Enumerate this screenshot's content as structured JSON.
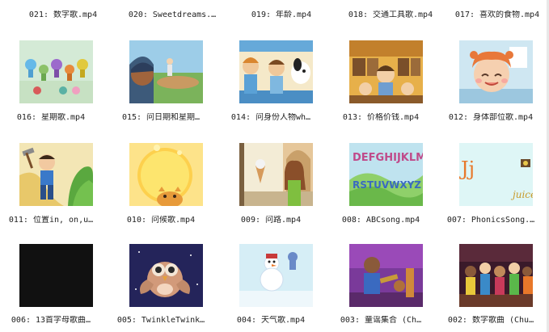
{
  "files": [
    {
      "label": "021: 数字歌.mp4",
      "icon": "video-file-icon"
    },
    {
      "label": "020: Sweetdreams.…",
      "icon": "video-file-icon"
    },
    {
      "label": "019: 年龄.mp4",
      "icon": "video-file-icon"
    },
    {
      "label": "018: 交通工具歌.mp4",
      "icon": "video-file-icon"
    },
    {
      "label": "017: 喜欢的食物.mp4",
      "icon": "video-file-icon"
    },
    {
      "label": "016: 星期歌.mp4",
      "icon": "video-thumbnail"
    },
    {
      "label": "015: 问日期和星期…",
      "icon": "video-thumbnail"
    },
    {
      "label": "014: 问身份人物wh…",
      "icon": "video-thumbnail"
    },
    {
      "label": "013: 价格价钱.mp4",
      "icon": "video-thumbnail"
    },
    {
      "label": "012: 身体部位歌.mp4",
      "icon": "video-thumbnail"
    },
    {
      "label": "011: 位置in, on,u…",
      "icon": "video-thumbnail"
    },
    {
      "label": "010: 问候歌.mp4",
      "icon": "video-thumbnail"
    },
    {
      "label": "009: 问路.mp4",
      "icon": "video-thumbnail"
    },
    {
      "label": "008: ABCsong.mp4",
      "icon": "video-thumbnail"
    },
    {
      "label": "007: PhonicsSong.…",
      "icon": "video-thumbnail"
    },
    {
      "label": "006: 13首字母歌曲…",
      "icon": "video-thumbnail"
    },
    {
      "label": "005: TwinkleTwink…",
      "icon": "video-thumbnail"
    },
    {
      "label": "004: 天气歌.mp4",
      "icon": "video-thumbnail"
    },
    {
      "label": "003: 童谣集合 (Ch…",
      "icon": "video-thumbnail"
    },
    {
      "label": "002: 数字歌曲 (Chu…",
      "icon": "video-thumbnail"
    }
  ],
  "thumb_text": {
    "abc_top": "DEFGHIJKLM",
    "abc_bottom": "RSTUVWXYZ",
    "jj": "Jj",
    "juice": "juice"
  }
}
